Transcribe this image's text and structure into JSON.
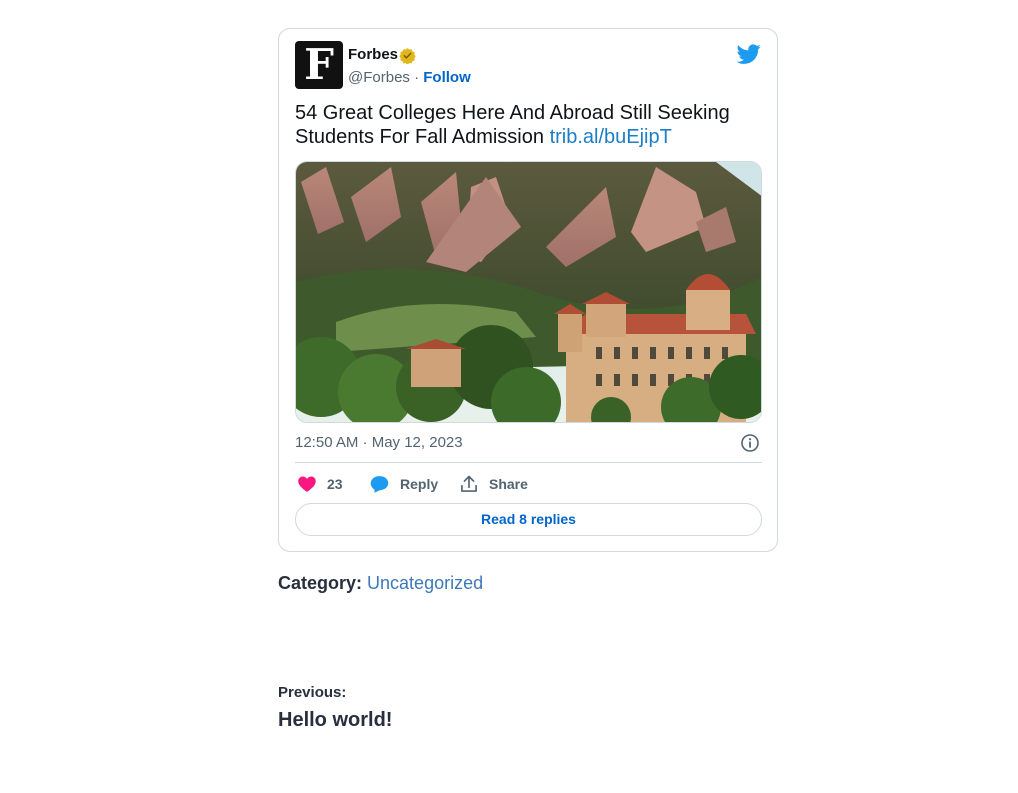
{
  "tweet": {
    "avatar_letter": "F",
    "author_name": "Forbes",
    "handle": "@Forbes",
    "separator": " · ",
    "follow_label": "Follow",
    "text": "54 Great Colleges Here And Abroad Still Seeking Students For Fall Admission ",
    "link_text": "trib.al/buEjipT",
    "timestamp": "12:50 AM · May 12, 2023",
    "like_count": "23",
    "reply_label": "Reply",
    "share_label": "Share",
    "read_replies_label": "Read 8 replies",
    "icons": {
      "avatar": "forbes-logo",
      "verified": "verified-badge-icon",
      "brand": "twitter-bird-icon",
      "info": "info-icon",
      "like": "heart-icon",
      "reply": "speech-bubble-icon",
      "share": "share-upload-icon"
    },
    "media_description": "mountain-flatirons-campus-photo"
  },
  "post": {
    "category_label": "Category:",
    "category_value": "Uncategorized",
    "previous_label": "Previous:",
    "previous_title": "Hello world!"
  },
  "colors": {
    "link_blue": "#1d7ec7",
    "follow_blue": "#0066cc",
    "twitter_blue": "#1d9bf0",
    "like_pink": "#f91880",
    "verified_gold": "#e2b719",
    "text_muted": "#536471",
    "border": "#cfd9de"
  }
}
